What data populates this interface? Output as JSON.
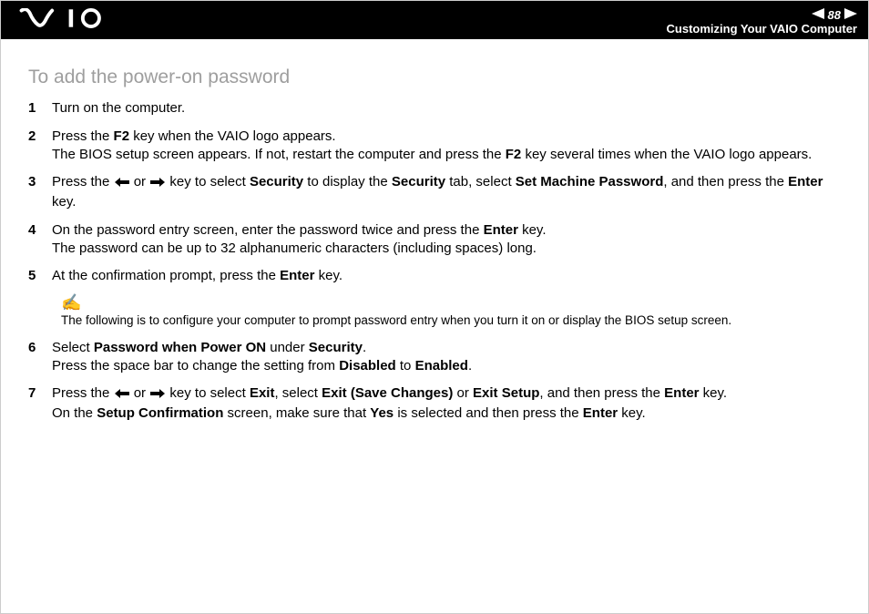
{
  "header": {
    "page_number": "88",
    "section": "Customizing Your VAIO Computer"
  },
  "heading": "To add the power-on password",
  "steps": [
    {
      "num": "1",
      "html": "Turn on the computer."
    },
    {
      "num": "2",
      "html": "Press the <b>F2</b> key when the VAIO logo appears.<br>The BIOS setup screen appears. If not, restart the computer and press the <b>F2</b> key several times when the VAIO logo appears."
    },
    {
      "num": "3",
      "html": "Press the <span class=\"inline-arrow\" data-name=\"left-arrow-icon\" data-interactable=\"false\"><svg width=\"16\" height=\"12\" viewBox=\"0 0 16 12\"><path d=\"M0 6 L6 1 L6 4 L16 4 L16 8 L6 8 L6 11 Z\" fill=\"#000\"/></svg></span> or <span class=\"inline-arrow\" data-name=\"right-arrow-icon\" data-interactable=\"false\"><svg width=\"16\" height=\"12\" viewBox=\"0 0 16 12\"><path d=\"M16 6 L10 1 L10 4 L0 4 L0 8 L10 8 L10 11 Z\" fill=\"#000\"/></svg></span> key to select <b>Security</b> to display the <b>Security</b> tab, select <b>Set Machine Password</b>, and then press the <b>Enter</b> key."
    },
    {
      "num": "4",
      "html": "On the password entry screen, enter the password twice and press the <b>Enter</b> key.<br>The password can be up to 32 alphanumeric characters (including spaces) long."
    },
    {
      "num": "5",
      "html": "At the confirmation prompt, press the <b>Enter</b> key."
    }
  ],
  "note": "The following is to configure your computer to prompt password entry when you turn it on or display the BIOS setup screen.",
  "steps2": [
    {
      "num": "6",
      "html": "Select <b>Password when Power ON</b> under <b>Security</b>.<br>Press the space bar to change the setting from <b>Disabled</b> to <b>Enabled</b>."
    },
    {
      "num": "7",
      "html": "Press the <span class=\"inline-arrow\" data-name=\"left-arrow-icon\" data-interactable=\"false\"><svg width=\"16\" height=\"12\" viewBox=\"0 0 16 12\"><path d=\"M0 6 L6 1 L6 4 L16 4 L16 8 L6 8 L6 11 Z\" fill=\"#000\"/></svg></span> or <span class=\"inline-arrow\" data-name=\"right-arrow-icon\" data-interactable=\"false\"><svg width=\"16\" height=\"12\" viewBox=\"0 0 16 12\"><path d=\"M16 6 L10 1 L10 4 L0 4 L0 8 L10 8 L10 11 Z\" fill=\"#000\"/></svg></span> key to select <b>Exit</b>, select <b>Exit (Save Changes)</b> or <b>Exit Setup</b>, and then press the <b>Enter</b> key.<br>On the <b>Setup Confirmation</b> screen, make sure that <b>Yes</b> is selected and then press the <b>Enter</b> key."
    }
  ]
}
